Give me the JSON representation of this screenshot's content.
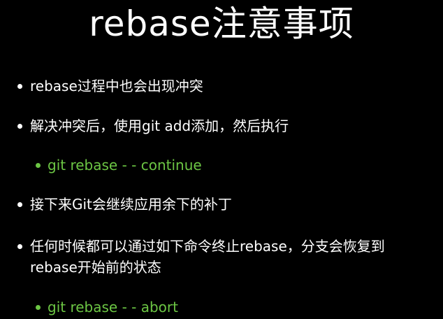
{
  "slide": {
    "title": "rebase注意事项",
    "bullets": [
      {
        "level": 1,
        "lines": [
          "rebase过程中也会出现冲突"
        ]
      },
      {
        "level": 1,
        "lines": [
          "解决冲突后，使用git add添加，然后执行"
        ]
      },
      {
        "level": 2,
        "lines": [
          "git rebase - - continue"
        ]
      },
      {
        "level": 1,
        "lines": [
          "接下来Git会继续应用余下的补丁"
        ]
      },
      {
        "level": 1,
        "lines": [
          "任何时候都可以通过如下命令终止rebase，分支会恢复到",
          "rebase开始前的状态"
        ]
      },
      {
        "level": 2,
        "lines": [
          "git rebase - - abort"
        ]
      }
    ]
  },
  "colors": {
    "background": "#000000",
    "text": "#ffffff",
    "sub_bullet": "#6cc644"
  }
}
